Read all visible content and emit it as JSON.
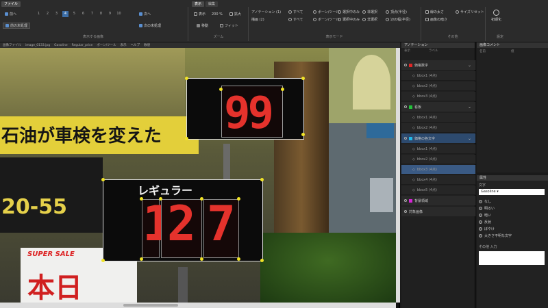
{
  "ribbon": {
    "tabs_left": [
      "ファイル"
    ],
    "tabs_right": [
      "表示",
      "編集"
    ],
    "nav": {
      "prev_label": "前へ",
      "next_label": "次へ",
      "prev_unlabeled_label": "前の未処理",
      "next_unlabeled_label": "次の未処理",
      "pages": [
        "1",
        "2",
        "3",
        "4",
        "5",
        "6",
        "7",
        "8",
        "9",
        "10"
      ],
      "selected_page": "4",
      "group_label": "表示する画像"
    },
    "zoom": {
      "level_label": "表示",
      "zoom_value": "200 %",
      "zoom_in_label": "拡大",
      "move_label": "移動",
      "fit_label": "フィット",
      "group_label": "ズーム"
    },
    "mode": {
      "annotation_label": "アノテーション (1)",
      "display_label": "描画 (2)",
      "row1": [
        "すべて",
        "ボーン/ツール",
        "選択中のみ",
        "非選択"
      ],
      "row2": [
        "すべて",
        "ボーン/ツール",
        "選択中のみ",
        "非選択"
      ],
      "col_a": [
        "頂点(半径)",
        "辺の幅(半径)"
      ],
      "group_label": "表示モード"
    },
    "other": {
      "items": [
        "線の太さ",
        "サイズリセット",
        "画像の暗さ"
      ],
      "group_label": "その他"
    },
    "settings": {
      "label": "初期化",
      "group_label": "設定"
    }
  },
  "viewport": {
    "tabs": [
      "画像ファイル",
      "image_0133.jpg",
      "Gasoline",
      "Regular_price",
      "ボーン/ツール",
      "表示",
      "ヘルプ",
      "数値"
    ],
    "scene": {
      "top_price": "99",
      "bottom_label": "レギュラー",
      "bottom_digits": [
        "1",
        "2",
        "7"
      ],
      "bottom_price": "127",
      "banner_text": "石油が車検を変えた",
      "phone_text": "20-55",
      "sale_text": "SUPER SALE",
      "day_text": "本日"
    }
  },
  "annotation_panel": {
    "title": "アノテーション",
    "columns": [
      "表示",
      "ラベル"
    ],
    "classes": [
      {
        "name": "価格数字",
        "color": "#e32626",
        "children": [
          "bbox1 (4点)",
          "bbox2 (4点)",
          "bbox3 (4点)"
        ]
      },
      {
        "name": "看板",
        "color": "#22c23a",
        "children": [
          "bbox1 (4点)",
          "bbox2 (4点)"
        ]
      },
      {
        "name": "価格の各文字",
        "color": "#22b8e8",
        "children": [
          "bbox1 (4点)",
          "bbox2 (4点)",
          "bbox3 (4点)",
          "bbox4 (4点)",
          "bbox5 (4点)"
        ]
      },
      {
        "name": "背景領域",
        "color": "#d623d6",
        "children": []
      },
      {
        "name": "対象画像",
        "color": "",
        "children": []
      }
    ]
  },
  "tree_panel": {
    "title": "画像コメント",
    "columns": [
      "名前",
      "値"
    ]
  },
  "props_panel": {
    "title": "属性",
    "select_label": "文字",
    "select_value": "Gasoline ▾",
    "options": [
      "なし",
      "明るい",
      "暗い",
      "反射",
      "ぼやけ",
      "大きさ不明な文字"
    ],
    "note_label": "その他 入力"
  }
}
